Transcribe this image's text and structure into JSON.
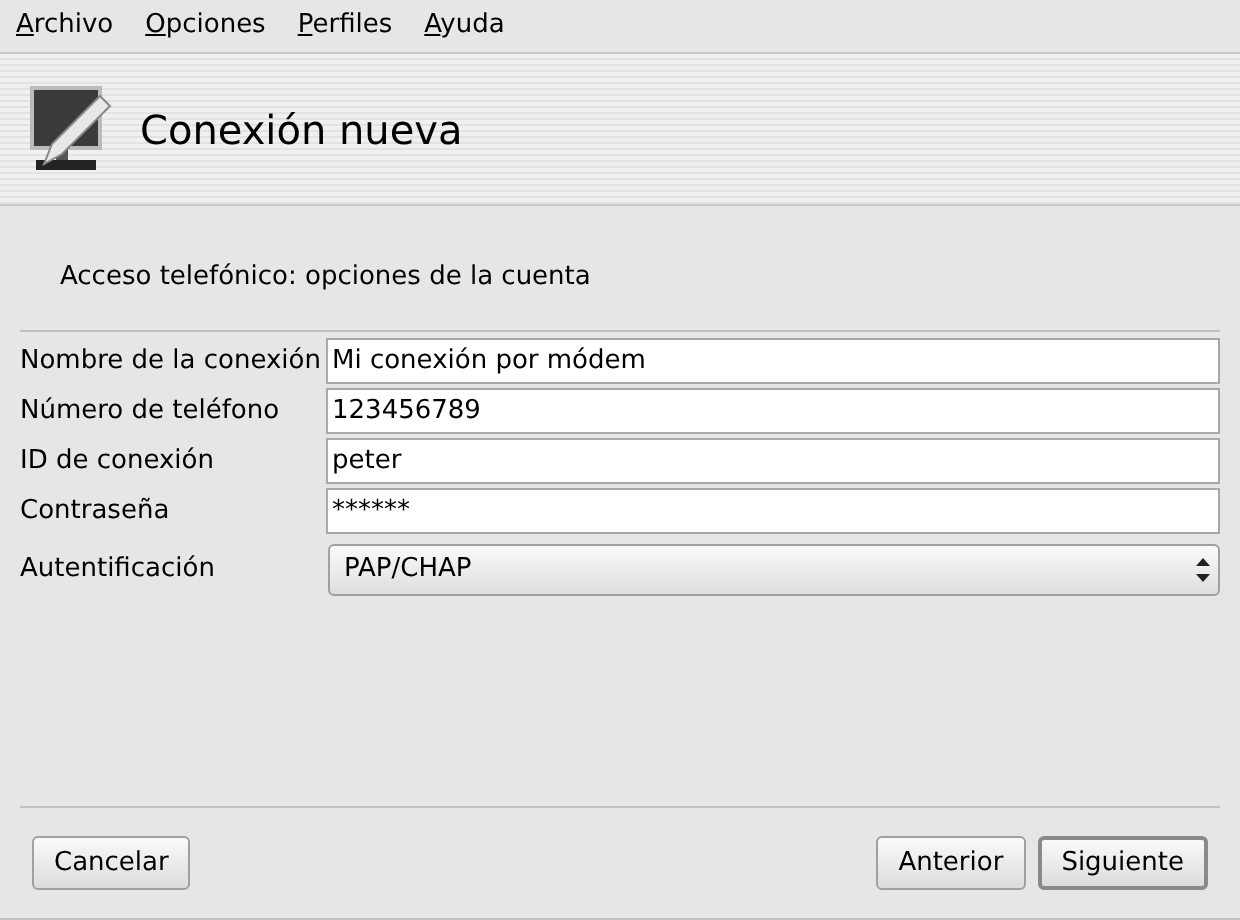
{
  "menu": [
    "Archivo",
    "Opciones",
    "Perfiles",
    "Ayuda"
  ],
  "header": {
    "title": "Conexión nueva"
  },
  "subtitle": "Acceso telefónico: opciones de la cuenta",
  "fields": [
    {
      "kind": "text",
      "label": "Nombre de la conexión",
      "value": "Mi conexión por módem"
    },
    {
      "kind": "text",
      "label": "Número de teléfono",
      "value": "123456789"
    },
    {
      "kind": "text",
      "label": "ID de conexión",
      "value": "peter"
    },
    {
      "kind": "text",
      "label": "Contraseña",
      "value": "******"
    },
    {
      "kind": "select",
      "label": "Autentificación",
      "value": "PAP/CHAP"
    }
  ],
  "buttons": {
    "left": [
      {
        "label": "Cancelar",
        "default": false
      }
    ],
    "right": [
      {
        "label": "Anterior",
        "default": false
      },
      {
        "label": "Siguiente",
        "default": true
      }
    ]
  }
}
